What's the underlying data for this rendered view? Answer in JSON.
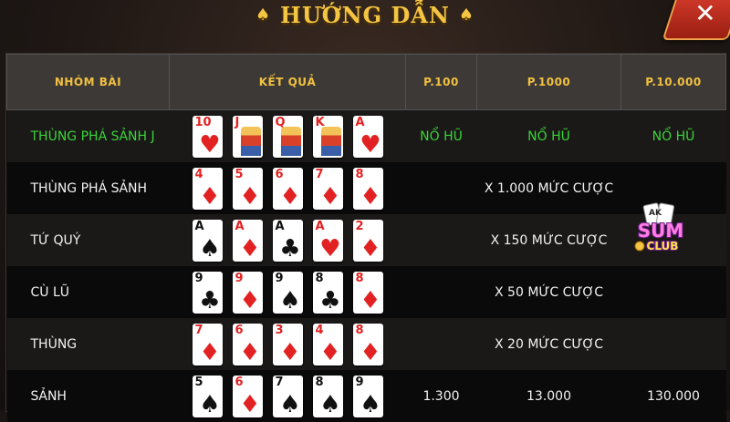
{
  "header": {
    "title": "HƯỚNG DẪN",
    "spade": "♠",
    "close_label": "✕"
  },
  "table": {
    "columns": [
      "NHÓM BÀI",
      "KẾT QUẢ",
      "P.100",
      "P.1000",
      "P.10.000"
    ],
    "rows": [
      {
        "group": "THÙNG PHÁ SẢNH J",
        "cards": [
          {
            "rank": "10",
            "suit": "♥",
            "color": "red",
            "face": false
          },
          {
            "rank": "J",
            "suit": "♥",
            "color": "red",
            "face": true
          },
          {
            "rank": "Q",
            "suit": "♥",
            "color": "red",
            "face": true
          },
          {
            "rank": "K",
            "suit": "♥",
            "color": "red",
            "face": true
          },
          {
            "rank": "A",
            "suit": "♥",
            "color": "red",
            "face": false
          }
        ],
        "p100": "NỔ HŨ",
        "p1000": "NỔ HŨ",
        "p10000": "NỔ HŨ"
      },
      {
        "group": "THÙNG PHÁ SẢNH",
        "cards": [
          {
            "rank": "4",
            "suit": "♦",
            "color": "red",
            "face": false
          },
          {
            "rank": "5",
            "suit": "♦",
            "color": "red",
            "face": false
          },
          {
            "rank": "6",
            "suit": "♦",
            "color": "red",
            "face": false
          },
          {
            "rank": "7",
            "suit": "♦",
            "color": "red",
            "face": false
          },
          {
            "rank": "8",
            "suit": "♦",
            "color": "red",
            "face": false
          }
        ],
        "merged": "X 1.000 MỨC CƯỢC"
      },
      {
        "group": "TỨ QUÝ",
        "cards": [
          {
            "rank": "A",
            "suit": "♠",
            "color": "blk",
            "face": false
          },
          {
            "rank": "A",
            "suit": "♦",
            "color": "red",
            "face": false
          },
          {
            "rank": "A",
            "suit": "♣",
            "color": "blk",
            "face": false
          },
          {
            "rank": "A",
            "suit": "♥",
            "color": "red",
            "face": false
          },
          {
            "rank": "2",
            "suit": "♦",
            "color": "red",
            "face": false
          }
        ],
        "merged": "X 150 MỨC CƯỢC"
      },
      {
        "group": "CÙ LŨ",
        "cards": [
          {
            "rank": "9",
            "suit": "♣",
            "color": "blk",
            "face": false
          },
          {
            "rank": "9",
            "suit": "♦",
            "color": "red",
            "face": false
          },
          {
            "rank": "9",
            "suit": "♠",
            "color": "blk",
            "face": false
          },
          {
            "rank": "8",
            "suit": "♣",
            "color": "blk",
            "face": false
          },
          {
            "rank": "8",
            "suit": "♦",
            "color": "red",
            "face": false
          }
        ],
        "merged": "X 50 MỨC CƯỢC"
      },
      {
        "group": "THÙNG",
        "cards": [
          {
            "rank": "7",
            "suit": "♦",
            "color": "red",
            "face": false
          },
          {
            "rank": "6",
            "suit": "♦",
            "color": "red",
            "face": false
          },
          {
            "rank": "3",
            "suit": "♦",
            "color": "red",
            "face": false
          },
          {
            "rank": "4",
            "suit": "♦",
            "color": "red",
            "face": false
          },
          {
            "rank": "8",
            "suit": "♦",
            "color": "red",
            "face": false
          }
        ],
        "merged": "X 20 MỨC CƯỢC"
      },
      {
        "group": "SẢNH",
        "cards": [
          {
            "rank": "5",
            "suit": "♠",
            "color": "blk",
            "face": false
          },
          {
            "rank": "6",
            "suit": "♦",
            "color": "red",
            "face": false
          },
          {
            "rank": "7",
            "suit": "♠",
            "color": "blk",
            "face": false
          },
          {
            "rank": "8",
            "suit": "♠",
            "color": "blk",
            "face": false
          },
          {
            "rank": "9",
            "suit": "♠",
            "color": "blk",
            "face": false
          }
        ],
        "p100": "1.300",
        "p1000": "13.000",
        "p10000": "130.000"
      }
    ]
  },
  "logo": {
    "icon": "sum-club-logo-icon",
    "text_top": "SUM",
    "text_bottom": "CLUB",
    "card_text": "AK"
  },
  "colors": {
    "gold": "#f0c040",
    "green": "#3ad43a",
    "red": "#e22222"
  }
}
